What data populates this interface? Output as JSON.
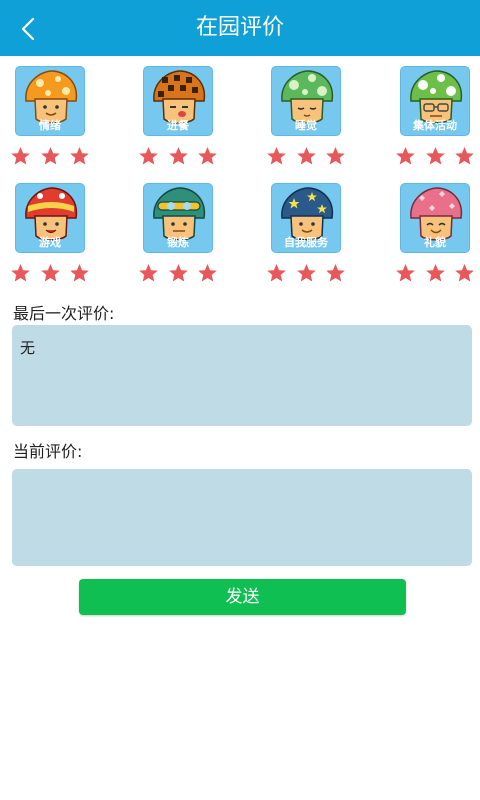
{
  "header": {
    "title": "在园评价",
    "back_icon": "chevron-left-icon"
  },
  "categories": [
    {
      "label": "情绪",
      "stars": 3
    },
    {
      "label": "进餐",
      "stars": 3
    },
    {
      "label": "睡觉",
      "stars": 3
    },
    {
      "label": "集体活动",
      "stars": 3
    },
    {
      "label": "游戏",
      "stars": 3
    },
    {
      "label": "锻炼",
      "stars": 3
    },
    {
      "label": "自我服务",
      "stars": 3
    },
    {
      "label": "礼貌",
      "stars": 3
    }
  ],
  "last_review": {
    "label": "最后一次评价:",
    "value": "无"
  },
  "current_review": {
    "label": "当前评价:",
    "value": ""
  },
  "send_button": {
    "label": "发送"
  },
  "colors": {
    "header": "#10a0d8",
    "tile": "#76c8ee",
    "star": "#e8585a",
    "textbox": "#bedbe6",
    "send": "#0fbf52"
  }
}
